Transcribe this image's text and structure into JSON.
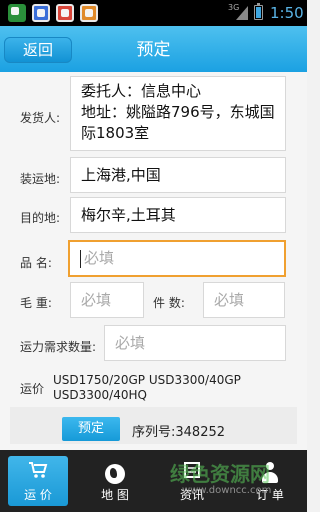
{
  "status_bar": {
    "network": "3G",
    "time": "1:50"
  },
  "header": {
    "back_label": "返回",
    "title": "预定"
  },
  "form": {
    "shipper": {
      "label": "发货人:",
      "value": "委托人：信息中心\n地址：姚隘路796号，东城国际1803室"
    },
    "loading_port": {
      "label": "装运地:",
      "value": "上海港,中国"
    },
    "destination": {
      "label": "目的地:",
      "value": "梅尔辛,土耳其"
    },
    "product_name": {
      "label": "品  名:",
      "placeholder": "必填"
    },
    "gross_weight": {
      "label": "毛  重:",
      "placeholder": "必填"
    },
    "pieces": {
      "label": "件  数:",
      "placeholder": "必填"
    },
    "capacity": {
      "label": "运力需求数量:",
      "placeholder": "必填"
    },
    "freight": {
      "label": "运价",
      "value": "USD1750/20GP USD3300/40GP USD3300/40HQ"
    }
  },
  "footer": {
    "order_button": "预定",
    "serial": "序列号:348252"
  },
  "nav": {
    "items": [
      {
        "label": "运 价",
        "icon": "cart-icon"
      },
      {
        "label": "地 图",
        "icon": "globe-icon"
      },
      {
        "label": "资讯",
        "icon": "news-icon"
      },
      {
        "label": "订 单",
        "icon": "person-icon"
      }
    ]
  },
  "watermark": {
    "text": "绿色资源网",
    "url": "www.downcc.com"
  },
  "colors": {
    "accent": "#1ba1e2",
    "focus_border": "#f0a030",
    "nav_background": "#222222"
  }
}
